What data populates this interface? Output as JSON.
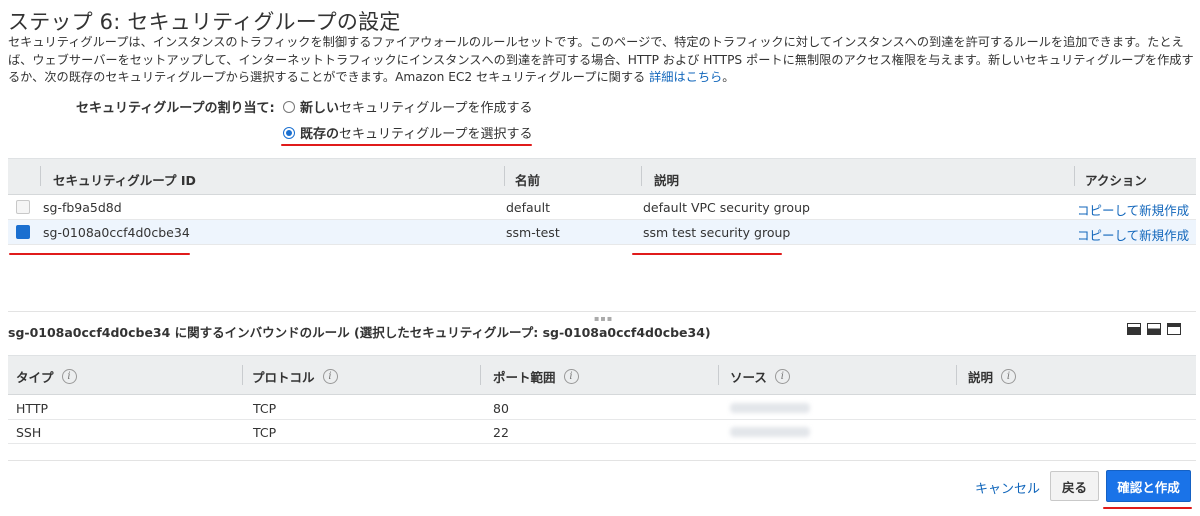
{
  "header": {
    "title": "ステップ 6: セキュリティグループの設定",
    "description": "セキュリティグループは、インスタンスのトラフィックを制御するファイアウォールのルールセットです。このページで、特定のトラフィックに対してインスタンスへの到達を許可するルールを追加できます。たとえば、ウェブサーバーをセットアップして、インターネットトラフィックにインスタンスへの到達を許可する場合、HTTP および HTTPS ポートに無制限のアクセス権限を与えます。新しいセキュリティグループを作成するか、次の既存のセキュリティグループから選択することができます。Amazon EC2 セキュリティグループに関する ",
    "details_link": "詳細はこちら",
    "period": "。"
  },
  "assignment": {
    "label": "セキュリティグループの割り当て:",
    "option_new_bold": "新しい",
    "option_new_rest": "セキュリティグループを作成する",
    "option_existing_bold": "既存の",
    "option_existing_rest": "セキュリティグループを選択する",
    "selected": "existing"
  },
  "sg_table": {
    "columns": [
      "セキュリティグループ ID",
      "名前",
      "説明",
      "アクション"
    ],
    "rows": [
      {
        "id": "sg-fb9a5d8d",
        "name": "default",
        "description": "default VPC security group",
        "action": "コピーして新規作成",
        "selected": false
      },
      {
        "id": "sg-0108a0ccf4d0cbe34",
        "name": "ssm-test",
        "description": "ssm test security group",
        "action": "コピーして新規作成",
        "selected": true
      }
    ]
  },
  "rules": {
    "title": "sg-0108a0ccf4d0cbe34 に関するインバウンドのルール (選択したセキュリティグループ: sg-0108a0ccf4d0cbe34)",
    "columns": [
      "タイプ",
      "プロトコル",
      "ポート範囲",
      "ソース",
      "説明"
    ],
    "rows": [
      {
        "type": "HTTP",
        "protocol": "TCP",
        "port": "80"
      },
      {
        "type": "SSH",
        "protocol": "TCP",
        "port": "22"
      }
    ]
  },
  "footer": {
    "cancel": "キャンセル",
    "back": "戻る",
    "confirm": "確認と作成"
  },
  "colors": {
    "accent": "#1a73e8",
    "link": "#1166bb",
    "highlight_underline": "#e01b1b"
  }
}
